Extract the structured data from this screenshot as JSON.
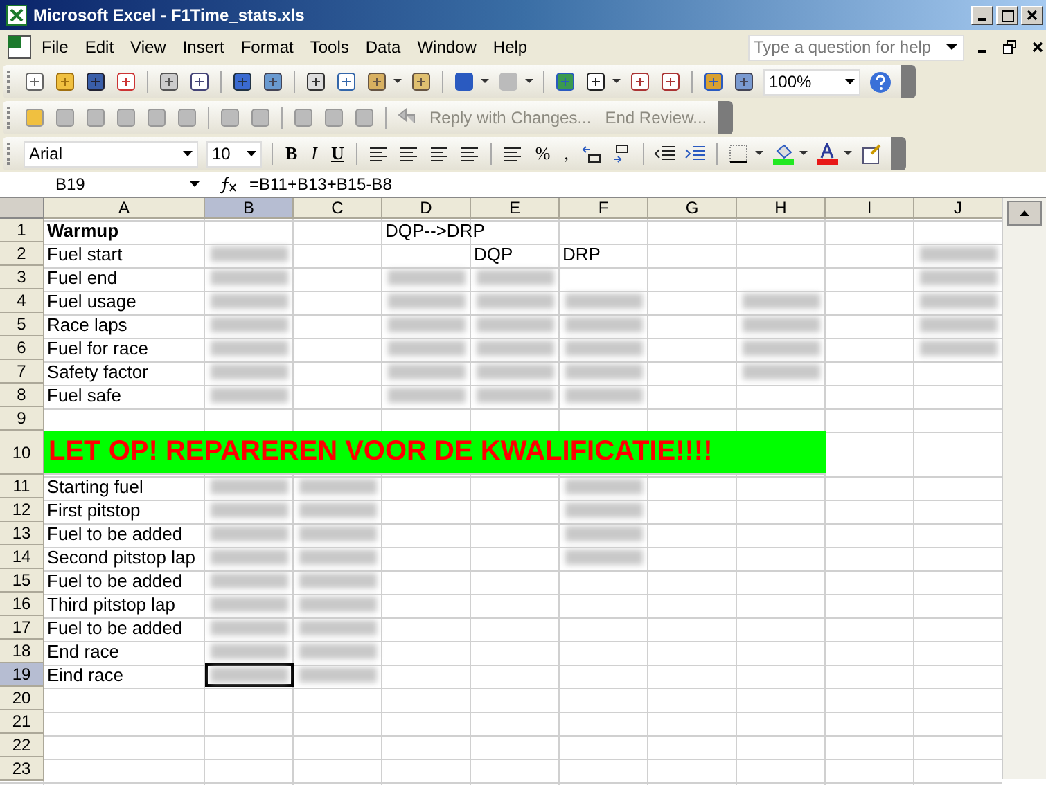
{
  "window": {
    "title": "Microsoft Excel - F1Time_stats.xls"
  },
  "menu": [
    {
      "label": "File"
    },
    {
      "label": "Edit"
    },
    {
      "label": "View"
    },
    {
      "label": "Insert"
    },
    {
      "label": "Format"
    },
    {
      "label": "Tools"
    },
    {
      "label": "Data"
    },
    {
      "label": "Window"
    },
    {
      "label": "Help"
    }
  ],
  "help_box": {
    "placeholder": "Type a question for help"
  },
  "standard_toolbar": {
    "zoom": "100%"
  },
  "reviewing_toolbar": [
    {
      "label": "Reply with Changes...",
      "disabled": true
    },
    {
      "label": "End Review...",
      "disabled": true
    }
  ],
  "formatting_toolbar": {
    "font": "Arial",
    "size": "10",
    "style_buttons": [
      "B",
      "I",
      "U"
    ],
    "percent": "%",
    "comma": ","
  },
  "formula_bar": {
    "name_box": "B19",
    "formula": "=B11+B13+B15-B8"
  },
  "columns": [
    {
      "label": "A",
      "selected": false
    },
    {
      "label": "B",
      "selected": true
    },
    {
      "label": "C",
      "selected": false
    },
    {
      "label": "D",
      "selected": false
    },
    {
      "label": "E",
      "selected": false
    },
    {
      "label": "F",
      "selected": false
    },
    {
      "label": "G",
      "selected": false
    },
    {
      "label": "H",
      "selected": false
    },
    {
      "label": "I",
      "selected": false
    },
    {
      "label": "J",
      "selected": false
    }
  ],
  "rows": [
    {
      "number": "1",
      "selected": false,
      "cells": [
        {
          "text": "Warmup",
          "bold": true
        },
        {},
        {},
        {
          "text": "DQP-->DRP"
        },
        {},
        {},
        {},
        {},
        {},
        {}
      ]
    },
    {
      "number": "2",
      "selected": false,
      "cells": [
        {
          "text": "Fuel start"
        },
        {
          "blurred": true
        },
        {},
        {},
        {
          "text": "DQP"
        },
        {
          "text": "DRP"
        },
        {},
        {},
        {},
        {
          "blurred": true
        }
      ]
    },
    {
      "number": "3",
      "selected": false,
      "cells": [
        {
          "text": "Fuel end"
        },
        {
          "blurred": true
        },
        {},
        {
          "blurred": true
        },
        {
          "blurred": true
        },
        {},
        {},
        {},
        {},
        {
          "blurred": true
        }
      ]
    },
    {
      "number": "4",
      "selected": false,
      "cells": [
        {
          "text": "Fuel usage"
        },
        {
          "blurred": true
        },
        {},
        {
          "blurred": true
        },
        {
          "blurred": true
        },
        {
          "blurred": true
        },
        {},
        {
          "blurred": true
        },
        {},
        {
          "blurred": true
        }
      ]
    },
    {
      "number": "5",
      "selected": false,
      "cells": [
        {
          "text": "Race laps"
        },
        {
          "blurred": true
        },
        {},
        {
          "blurred": true
        },
        {
          "blurred": true
        },
        {
          "blurred": true
        },
        {},
        {
          "blurred": true
        },
        {},
        {
          "blurred": true
        }
      ]
    },
    {
      "number": "6",
      "selected": false,
      "cells": [
        {
          "text": "Fuel for race"
        },
        {
          "blurred": true
        },
        {},
        {
          "blurred": true
        },
        {
          "blurred": true
        },
        {
          "blurred": true
        },
        {},
        {
          "blurred": true
        },
        {},
        {
          "blurred": true
        }
      ]
    },
    {
      "number": "7",
      "selected": false,
      "cells": [
        {
          "text": "Safety factor"
        },
        {
          "blurred": true
        },
        {},
        {
          "blurred": true
        },
        {
          "blurred": true
        },
        {
          "blurred": true
        },
        {},
        {
          "blurred": true
        },
        {},
        {}
      ]
    },
    {
      "number": "8",
      "selected": false,
      "cells": [
        {
          "text": "Fuel safe"
        },
        {
          "blurred": true
        },
        {},
        {
          "blurred": true
        },
        {
          "blurred": true
        },
        {
          "blurred": true
        },
        {},
        {},
        {},
        {}
      ]
    },
    {
      "number": "9",
      "selected": false,
      "cells": [
        {},
        {},
        {},
        {},
        {},
        {},
        {},
        {},
        {},
        {}
      ]
    },
    {
      "number": "10",
      "selected": false,
      "kind": "banner",
      "text": "LET OP! REPAREREN VOOR DE KWALIFICATIE!!!!"
    },
    {
      "number": "11",
      "selected": false,
      "cells": [
        {
          "text": "Starting fuel"
        },
        {
          "blurred": true
        },
        {
          "blurred": true
        },
        {},
        {},
        {
          "blurred": true
        },
        {},
        {},
        {},
        {}
      ]
    },
    {
      "number": "12",
      "selected": false,
      "cells": [
        {
          "text": "First pitstop"
        },
        {
          "blurred": true
        },
        {
          "blurred": true
        },
        {},
        {},
        {
          "blurred": true
        },
        {},
        {},
        {},
        {}
      ]
    },
    {
      "number": "13",
      "selected": false,
      "cells": [
        {
          "text": "Fuel to be added"
        },
        {
          "blurred": true
        },
        {
          "blurred": true
        },
        {},
        {},
        {
          "blurred": true
        },
        {},
        {},
        {},
        {}
      ]
    },
    {
      "number": "14",
      "selected": false,
      "cells": [
        {
          "text": "Second pitstop lap"
        },
        {
          "blurred": true
        },
        {
          "blurred": true
        },
        {},
        {},
        {
          "blurred": true
        },
        {},
        {},
        {},
        {}
      ]
    },
    {
      "number": "15",
      "selected": false,
      "cells": [
        {
          "text": "Fuel to be added"
        },
        {
          "blurred": true
        },
        {
          "blurred": true
        },
        {},
        {},
        {},
        {},
        {},
        {},
        {}
      ]
    },
    {
      "number": "16",
      "selected": false,
      "cells": [
        {
          "text": "Third pitstop lap"
        },
        {
          "blurred": true
        },
        {
          "blurred": true
        },
        {},
        {},
        {},
        {},
        {},
        {},
        {}
      ]
    },
    {
      "number": "17",
      "selected": false,
      "cells": [
        {
          "text": "Fuel to be added"
        },
        {
          "blurred": true
        },
        {
          "blurred": true
        },
        {},
        {},
        {},
        {},
        {},
        {},
        {}
      ]
    },
    {
      "number": "18",
      "selected": false,
      "cells": [
        {
          "text": "End race"
        },
        {
          "blurred": true
        },
        {
          "blurred": true
        },
        {},
        {},
        {},
        {},
        {},
        {},
        {}
      ]
    },
    {
      "number": "19",
      "selected": true,
      "cells": [
        {
          "text": "Eind race"
        },
        {
          "blurred": true,
          "active": true
        },
        {
          "blurred": true
        },
        {},
        {},
        {},
        {},
        {},
        {},
        {}
      ]
    },
    {
      "number": "20",
      "selected": false,
      "cells": [
        {},
        {},
        {},
        {},
        {},
        {},
        {},
        {},
        {},
        {}
      ]
    },
    {
      "number": "21",
      "selected": false,
      "cells": [
        {},
        {},
        {},
        {},
        {},
        {},
        {},
        {},
        {},
        {}
      ]
    },
    {
      "number": "22",
      "selected": false,
      "cells": [
        {},
        {},
        {},
        {},
        {},
        {},
        {},
        {},
        {},
        {}
      ]
    },
    {
      "number": "23",
      "selected": false,
      "cells": [
        {},
        {},
        {},
        {},
        {},
        {},
        {},
        {},
        {},
        {}
      ]
    }
  ]
}
